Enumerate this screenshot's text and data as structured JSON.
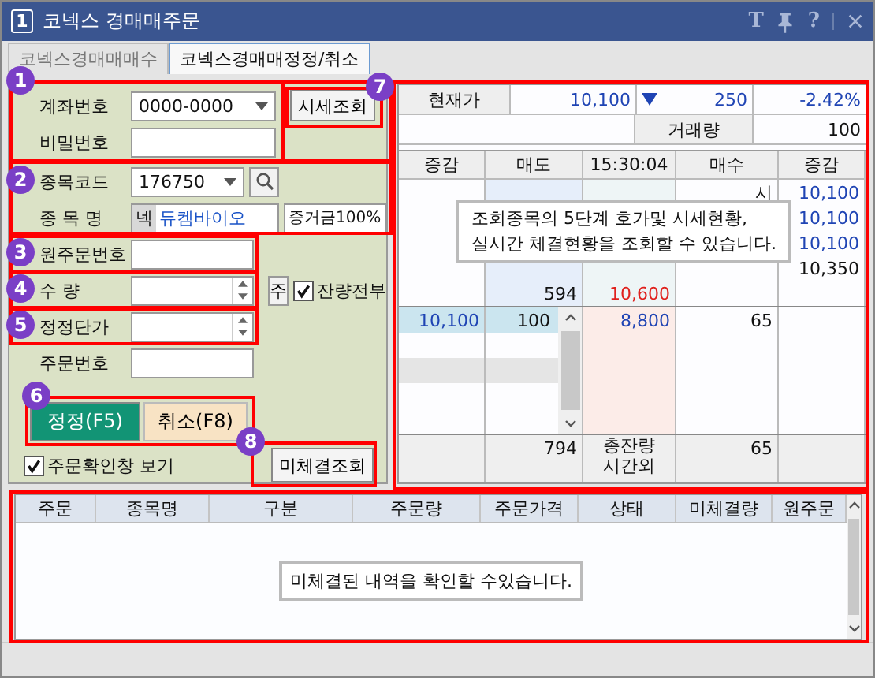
{
  "window": {
    "app_badge": "1",
    "title": "코넥스 경매매주문",
    "controls": [
      {
        "kind": "glyph",
        "label": "T"
      },
      {
        "kind": "pin"
      },
      {
        "kind": "glyph",
        "label": "?"
      },
      {
        "kind": "close"
      }
    ]
  },
  "tabs": [
    {
      "label": "코넥스경매매매수",
      "selected": false
    },
    {
      "label": "코넥스경매매정정/취소",
      "selected": true
    }
  ],
  "form": {
    "account_label": "계좌번호",
    "account_value": "0000-0000",
    "password_label": "비밀번호",
    "quote_button": "시세조회",
    "code_label": "종목코드",
    "code_value": "176750",
    "name_label": "종 목 명",
    "name_prefix": "넥",
    "name_value": "듀켐바이오",
    "margin": "증거금100%",
    "orig_order_label": "원주문번호",
    "qty_label": "수  량",
    "qty_unit": "주",
    "remain_all": {
      "label": "잔량전부",
      "checked": true
    },
    "price_label": "정정단가",
    "order_no_label": "주문번호",
    "modify_button": "정정(F5)",
    "cancel_button": "취소(F8)",
    "confirm": {
      "label": "주문확인창 보기",
      "checked": true
    },
    "unfilled_button": "미체결조회"
  },
  "quote": {
    "current_label": "현재가",
    "current": "10,100",
    "falling": true,
    "change": "250",
    "rate": "-2.42%",
    "volume_label": "거래량",
    "volume": "100"
  },
  "orderbook": {
    "columns": [
      "증감",
      "매도",
      "15:30:04",
      "매수",
      "증감"
    ],
    "ask_rows": [
      {
        "cells": [
          null,
          null,
          null,
          {
            "text": "시"
          },
          {
            "text": "10,100",
            "color": "#1f44b4"
          }
        ]
      },
      {
        "cells": [
          null,
          null,
          null,
          null,
          {
            "text": "10,100",
            "color": "#1f44b4"
          }
        ]
      },
      {
        "cells": [
          null,
          null,
          null,
          null,
          {
            "text": "10,100",
            "color": "#1f44b4"
          }
        ]
      },
      {
        "cells": [
          null,
          null,
          null,
          null,
          {
            "text": "10,350"
          }
        ]
      },
      {
        "cells": [
          null,
          {
            "text": "594"
          },
          {
            "text": "10,600",
            "color": "#e0201c"
          },
          null,
          null
        ]
      }
    ],
    "bid_rows": [
      {
        "cells": [
          {
            "text": "10,100",
            "color": "#1f44b4"
          },
          {
            "text": "100"
          },
          {
            "text": "8,800",
            "color": "#1f44b4"
          },
          {
            "text": "65"
          },
          null
        ]
      }
    ],
    "footer": {
      "ask_total": "794",
      "label": "총잔량",
      "label2": "시간외",
      "bid_total": "65"
    },
    "tooltip": "조회종목의 5단계 호가및 시세현황,\n실시간 체결현황을 조회할 수 있습니다."
  },
  "orders": {
    "columns": [
      "주문",
      "종목명",
      "구분",
      "주문량",
      "주문가격",
      "상태",
      "미체결량",
      "원주문"
    ],
    "message": "미체결된 내역을 확인할 수있습니다."
  },
  "annotations": [
    "1",
    "2",
    "3",
    "4",
    "5",
    "6",
    "7",
    "8"
  ]
}
